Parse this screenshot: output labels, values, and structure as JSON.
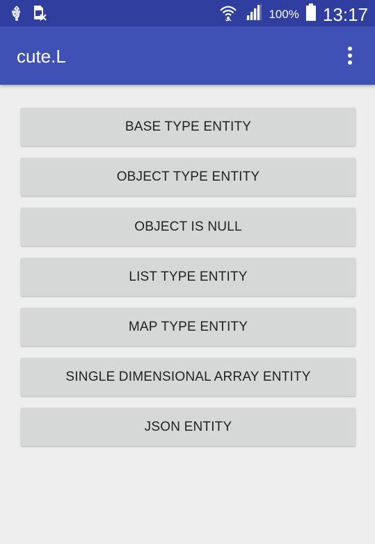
{
  "status_bar": {
    "left_icons": [
      "usb-icon",
      "sim-card-icon"
    ],
    "right_icons": [
      "wifi-icon",
      "signal-icon",
      "battery-icon"
    ],
    "battery_percent": "100%",
    "time": "13:17"
  },
  "app_bar": {
    "title": "cute.L",
    "menu_icon": "overflow-menu-icon"
  },
  "buttons": [
    {
      "label": "BASE TYPE ENTITY"
    },
    {
      "label": "OBJECT TYPE ENTITY"
    },
    {
      "label": "OBJECT IS NULL"
    },
    {
      "label": "LIST TYPE ENTITY"
    },
    {
      "label": "MAP TYPE ENTITY"
    },
    {
      "label": "SINGLE DIMENSIONAL ARRAY ENTITY"
    },
    {
      "label": "JSON ENTITY"
    }
  ],
  "colors": {
    "status_bar": "#303f9f",
    "app_bar": "#3f51b5",
    "background": "#eeeeee",
    "button": "#d6d7d7",
    "button_text": "#222222"
  }
}
